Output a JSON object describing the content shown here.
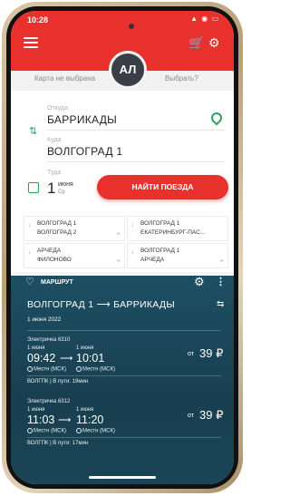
{
  "status": {
    "time": "10:28",
    "icons": "▲ ◉ ▭"
  },
  "header": {
    "avatar": "АЛ",
    "card_left": "Карта не выбрана",
    "card_right": "Выбрать?"
  },
  "form": {
    "from_label": "Откуда",
    "from_value": "БАРРИКАДЫ",
    "to_label": "Куда",
    "to_value": "ВОЛГОГРАД 1",
    "date_label": "Туда",
    "date_day": "1",
    "date_month": "июня",
    "date_weekday": "Ср",
    "find_button": "НАЙТИ ПОЕЗДА"
  },
  "recents": [
    {
      "line1": "ВОЛГОГРАД 1",
      "line2": "ВОЛГОГРАД 2"
    },
    {
      "line1": "ВОЛГОГРАД 1",
      "line2": "ЕКАТЕРИНБУРГ-ПАС..."
    },
    {
      "line1": "АРЧЕДА",
      "line2": "ФИЛОНОВО"
    },
    {
      "line1": "ВОЛГОГРАД 1",
      "line2": "АРЧЕДА"
    }
  ],
  "route": {
    "save_label": "МАРШРУТ",
    "title": "ВОЛГОГРАД 1 ⟶ БАРРИКАДЫ",
    "date": "1 июня 2022"
  },
  "trains": [
    {
      "name": "Электричка 6310",
      "dep_date": "1 июня",
      "arr_date": "1 июня",
      "dep_time": "09:42",
      "arr_time": "10:01",
      "dep_tz": "Местн (МСК)",
      "arr_tz": "Местн (МСК)",
      "price_from": "от",
      "price": "39 ₽",
      "footer": "ВОЛГПК | В пути: 19мин"
    },
    {
      "name": "Электричка 6312",
      "dep_date": "1 июня",
      "arr_date": "1 июня",
      "dep_time": "11:03",
      "arr_time": "11:20",
      "dep_tz": "Местн (МСК)",
      "arr_tz": "Местн (МСК)",
      "price_from": "от",
      "price": "39 ₽",
      "footer": "ВОЛГПК | В пути: 17мин"
    }
  ],
  "colors": {
    "brand_red": "#e8302c",
    "accent_green": "#2e9e5a",
    "dark_panel": "#1d4f63"
  }
}
